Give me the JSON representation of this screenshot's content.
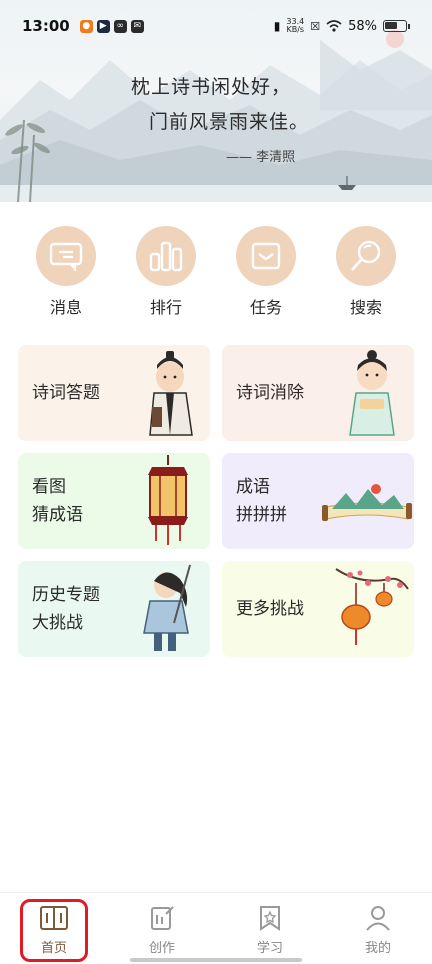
{
  "status_bar": {
    "time": "13:00",
    "net_speed_value": "33.4",
    "net_speed_unit": "KB/s",
    "battery": "58%"
  },
  "banner": {
    "poem_line1": "枕上诗书闲处好，",
    "poem_line2": "门前风景雨来佳。",
    "author": "—— 李清照"
  },
  "quick_actions": [
    {
      "label": "消息",
      "icon": "message-icon"
    },
    {
      "label": "排行",
      "icon": "ranking-icon"
    },
    {
      "label": "任务",
      "icon": "task-icon"
    },
    {
      "label": "搜索",
      "icon": "search-icon"
    }
  ],
  "cards": [
    {
      "line1": "诗词答题",
      "line2": "",
      "bg": "#fbf3ea"
    },
    {
      "line1": "诗词消除",
      "line2": "",
      "bg": "#fbefe9"
    },
    {
      "line1": "看图",
      "line2": "猜成语",
      "bg": "#ecfbe8"
    },
    {
      "line1": "成语",
      "line2": "拼拼拼",
      "bg": "#f1ecfb"
    },
    {
      "line1": "历史专题",
      "line2": "大挑战",
      "bg": "#e9f9f1"
    },
    {
      "line1": "更多挑战",
      "line2": "",
      "bg": "#f9fde7"
    }
  ],
  "bottom_nav": [
    {
      "label": "首页",
      "icon": "home-book-icon",
      "active": true
    },
    {
      "label": "创作",
      "icon": "create-icon",
      "active": false
    },
    {
      "label": "学习",
      "icon": "study-bookmark-icon",
      "active": false
    },
    {
      "label": "我的",
      "icon": "profile-icon",
      "active": false
    }
  ],
  "colors": {
    "accent": "#7a5a3a",
    "quick_circle": "#efd3bb",
    "nav_highlight": "#e01b24"
  }
}
